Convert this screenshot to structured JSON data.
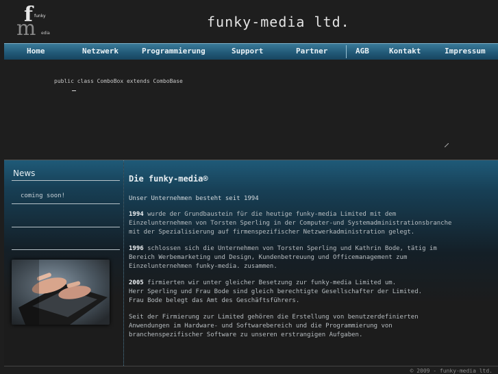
{
  "header": {
    "logo": {
      "letters": "mf",
      "funky": "funky",
      "edia": "edia"
    },
    "title": "funky-media ltd."
  },
  "nav": {
    "items": [
      "Home",
      "Netzwerk",
      "Programmierung",
      "Support",
      "Partner",
      "AGB",
      "Kontakt",
      "Impressum"
    ]
  },
  "code": {
    "line": "public class ComboBox extends ComboBase"
  },
  "news": {
    "title": "News",
    "item": "coming soon!"
  },
  "content": {
    "title": "Die funky-media®",
    "subtitle": "Unser Unternehmen besteht seit 1994",
    "paragraphs": [
      {
        "year": "1994",
        "text": " wurde der Grundbaustein für die heutige funky-media Limited mit dem\nEinzelunternehmen von Torsten Sperling in der Computer-und Systemadministrationsbranche\nmit der Spezialisierung auf firmenspezifischer Netzwerkadministration gelegt."
      },
      {
        "year": "1996",
        "text": " schlossen sich die Unternehmen von Torsten Sperling und Kathrin Bode, tätig im\nBereich Werbemarketing und Design, Kundenbetreuung und Officemanagement zum\nEinzelunternehmen funky-media. zusammen."
      },
      {
        "year": "2005",
        "text": " firmierten wir unter gleicher Besetzung zur funky-media Limited um.\nHerr Sperling und Frau Bode sind gleich berechtigte Gesellschafter der Limited.\nFrau Bode belegt das Amt des Geschäftsführers."
      },
      {
        "year": "",
        "text": "Seit der Firmierung zur Limited gehören die Erstellung von benutzerdefinierten\nAnwendungen im Hardware- und Softwarebereich und die Programmierung von\nbranchenspezifischer Software zu unseren erstrangigen Aufgaben."
      }
    ]
  },
  "footer": {
    "text": "© 2009 - funky-media ltd."
  }
}
